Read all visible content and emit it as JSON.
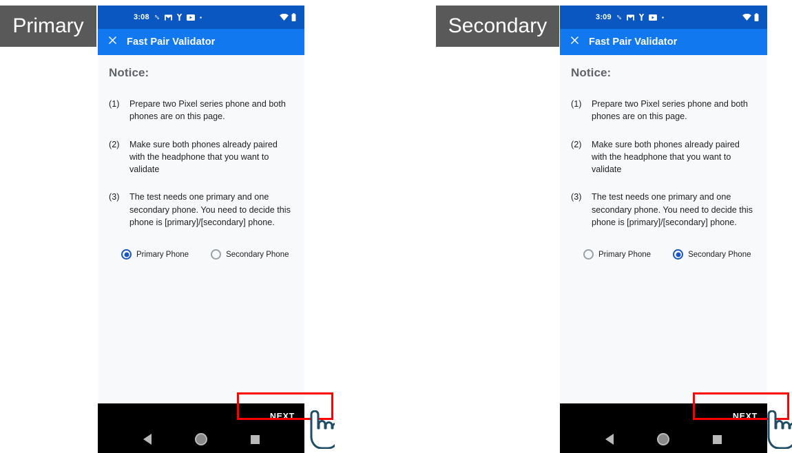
{
  "annotations": {
    "primary_label": "Primary",
    "secondary_label": "Secondary"
  },
  "colors": {
    "status_bar": "#0a57c2",
    "app_bar": "#1278f0",
    "content_bg": "#f8f9fa",
    "accent_radio": "#1a56c4",
    "highlight": "#ff0000",
    "bottom_bar": "#000000",
    "annotation_chip": "#595959",
    "cursor_outline": "#1f4e66"
  },
  "phones": [
    {
      "name": "primary",
      "status_bar": {
        "clock": "3:08",
        "icons": [
          "chain-icon",
          "gmail-icon",
          "vpn-key-icon",
          "youtube-icon",
          "dot-icon"
        ],
        "right_icons": [
          "wifi-icon",
          "battery-icon"
        ]
      },
      "app_bar": {
        "close_icon": "close-icon",
        "title": "Fast Pair Validator"
      },
      "content": {
        "heading": "Notice:",
        "items": [
          {
            "num": "(1)",
            "text": "Prepare two Pixel series phone and both phones are on this page."
          },
          {
            "num": "(2)",
            "text": "Make sure both phones already paired with the headphone that you want to validate"
          },
          {
            "num": "(3)",
            "text": "The test needs one primary and one secondary phone. You need to decide this phone is [primary]/[secondary] phone."
          }
        ],
        "radio_options": [
          {
            "label": "Primary Phone",
            "selected": true
          },
          {
            "label": "Secondary Phone",
            "selected": false
          }
        ]
      },
      "bottom": {
        "next_label": "NEXT",
        "nav": [
          "back-button",
          "home-button",
          "recents-button"
        ]
      }
    },
    {
      "name": "secondary",
      "status_bar": {
        "clock": "3:09",
        "icons": [
          "chain-icon",
          "gmail-icon",
          "vpn-key-icon",
          "youtube-icon",
          "dot-icon"
        ],
        "right_icons": [
          "wifi-icon",
          "battery-icon"
        ]
      },
      "app_bar": {
        "close_icon": "close-icon",
        "title": "Fast Pair Validator"
      },
      "content": {
        "heading": "Notice:",
        "items": [
          {
            "num": "(1)",
            "text": "Prepare two Pixel series phone and both phones are on this page."
          },
          {
            "num": "(2)",
            "text": "Make sure both phones already paired with the headphone that you want to validate"
          },
          {
            "num": "(3)",
            "text": "The test needs one primary and one secondary phone. You need to decide this phone is [primary]/[secondary] phone."
          }
        ],
        "radio_options": [
          {
            "label": "Primary Phone",
            "selected": false
          },
          {
            "label": "Secondary Phone",
            "selected": true
          }
        ]
      },
      "bottom": {
        "next_label": "NEXT",
        "nav": [
          "back-button",
          "home-button",
          "recents-button"
        ]
      }
    }
  ]
}
